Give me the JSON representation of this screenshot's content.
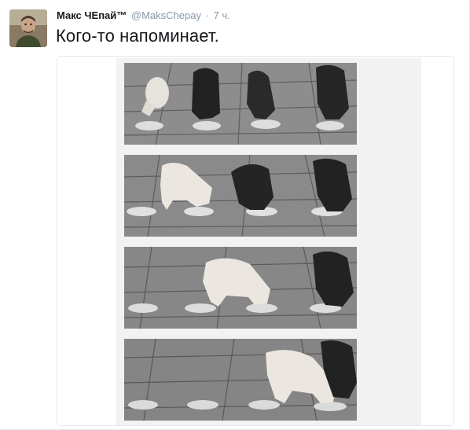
{
  "tweet": {
    "author": {
      "name": "Макс ЧЕпай™",
      "handle": "@MaksChepay",
      "separator": "·",
      "time": "7 ч."
    },
    "text": "Кого-то напоминает.",
    "media": {
      "icon": "photo-icon",
      "panels": [
        {
          "subjects": [
            "piglet",
            "dachshund",
            "dachshund",
            "dachshund"
          ]
        },
        {
          "subjects": [
            "piglet",
            "dachshund",
            "dachshund"
          ]
        },
        {
          "subjects": [
            "piglet",
            "dachshund"
          ]
        },
        {
          "subjects": [
            "piglet",
            "dachshund"
          ]
        }
      ]
    }
  },
  "colors": {
    "text": "#14171a",
    "secondary": "#8899a6",
    "border": "#e1e8ed",
    "photo_mat": "#f2f2f2"
  }
}
